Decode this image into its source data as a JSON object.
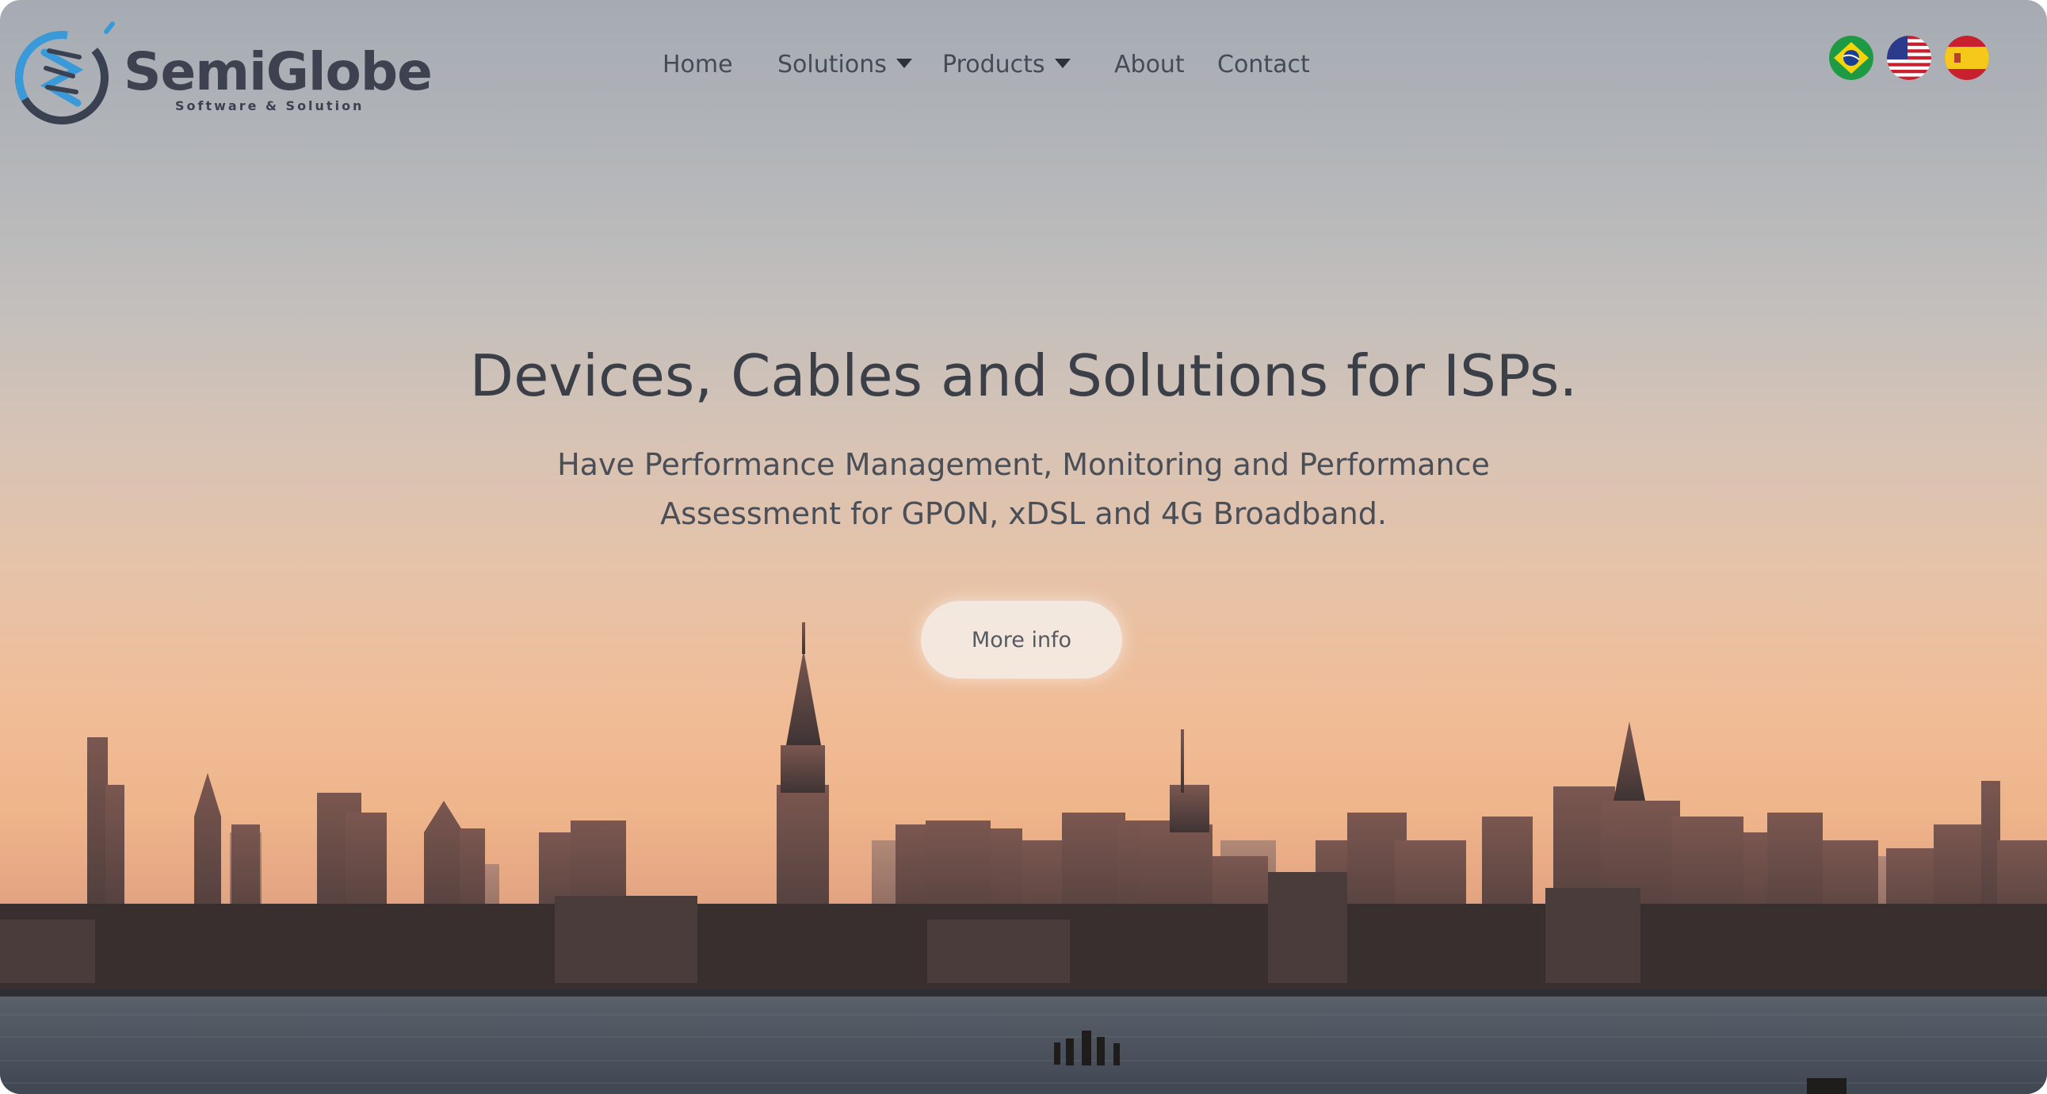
{
  "header": {
    "logo": {
      "name": "SemiGlobe",
      "tagline": "Software & Solution"
    },
    "nav": [
      {
        "label": "Home"
      },
      {
        "label": "Solutions",
        "has_dropdown": true
      },
      {
        "label": "Products",
        "has_dropdown": true
      },
      {
        "label": "About"
      },
      {
        "label": "Contact"
      }
    ],
    "languages": [
      {
        "icon": "brazil-flag-icon"
      },
      {
        "icon": "usa-flag-icon"
      },
      {
        "icon": "spain-flag-icon"
      }
    ]
  },
  "hero": {
    "title": "Devices, Cables and Solutions for ISPs.",
    "subtitle_line1": "Have Performance Management, Monitoring and Performance",
    "subtitle_line2": "Assessment for GPON, xDSL and 4G Broadband.",
    "button_label": "More info",
    "background": "city-skyline-sunset-photo"
  },
  "colors": {
    "logo_blue": "#3a9ad9",
    "logo_text": "#3e4250",
    "nav_text": "#454a55",
    "title_text": "#3b3f48",
    "sky_top": "#a6abb3",
    "sky_horizon": "#f0bd98"
  }
}
